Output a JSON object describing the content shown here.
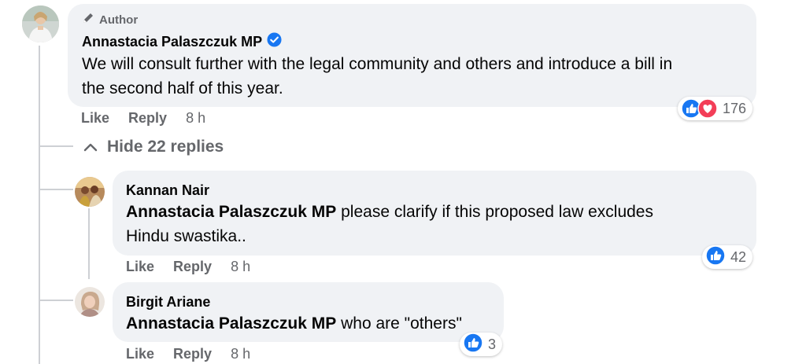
{
  "top_comment": {
    "badge": "Author",
    "author": "Annastacia Palaszczuk MP",
    "verified_icon": "verified-badge-icon",
    "text_line1": "We will consult further with the legal community and others and introduce a bill in",
    "text_line2": "the second half of this year.",
    "reaction_count": "176",
    "reaction_icons": [
      "like-reaction-icon",
      "love-reaction-icon"
    ],
    "actions": {
      "like": "Like",
      "reply": "Reply",
      "time": "8 h"
    }
  },
  "replies_toggle": {
    "label": "Hide 22 replies",
    "icon": "chevron-up-icon"
  },
  "replies": [
    {
      "author": "Kannan Nair",
      "mention": "Annastacia Palaszczuk MP",
      "text_after_mention": " please clarify if this proposed law excludes",
      "text_line2": "Hindu swastika..",
      "reaction_count": "42",
      "actions": {
        "like": "Like",
        "reply": "Reply",
        "time": "8 h"
      }
    },
    {
      "author": "Birgit Ariane",
      "mention": "Annastacia Palaszczuk MP",
      "text_after_mention": " who are \"others\"",
      "reaction_count": "3",
      "actions": {
        "like": "Like",
        "reply": "Reply",
        "time": "8 h"
      }
    }
  ],
  "colors": {
    "bubble": "#f0f2f5",
    "secondary_text": "#65676b",
    "like_blue": "#1877f2",
    "love_red": "#f33e58",
    "thread_line": "#ced0d4"
  }
}
